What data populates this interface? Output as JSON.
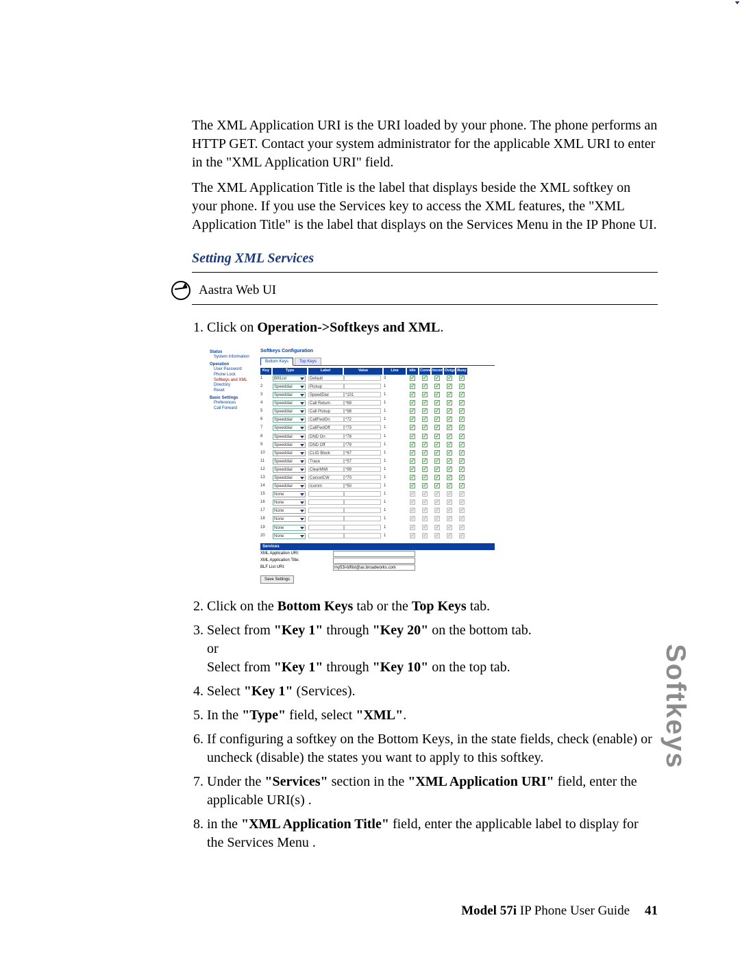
{
  "paragraphs": {
    "p1": "The XML Application URI is the URI loaded by your phone. The phone performs an HTTP GET. Contact your system administrator for the applicable XML URI to enter in the \"XML Application URI\" field.",
    "p2": "The XML Application Title is the label that displays beside the XML softkey on your phone. If you use the Services key to access the XML features, the \"XML Application Title\" is the label that displays on the Services Menu in the IP Phone UI."
  },
  "section_heading": "Setting XML Services",
  "globe_label": "Aastra Web UI",
  "steps": {
    "s1_a": "Click on ",
    "s1_b": "Operation->Softkeys and XML",
    "s1_c": ".",
    "s2_a": "Click on the ",
    "s2_b": "Bottom Keys",
    "s2_c": " tab or the ",
    "s2_d": "Top Keys",
    "s2_e": " tab.",
    "s3_a": "Select from ",
    "s3_b": "\"Key 1\"",
    "s3_c": " through ",
    "s3_d": "\"Key 20\"",
    "s3_e": " on the bottom tab.",
    "s3_or": "or",
    "s3_f": "Select from ",
    "s3_g": "\"Key 1\"",
    "s3_h": " through ",
    "s3_i": "\"Key 10\"",
    "s3_j": " on the top tab.",
    "s4_a": "Select ",
    "s4_b": "\"Key 1\"",
    "s4_c": " (Services).",
    "s5_a": "In the ",
    "s5_b": "\"Type\"",
    "s5_c": " field, select ",
    "s5_d": "\"XML\"",
    "s5_e": ".",
    "s6": "If configuring a softkey on the Bottom Keys, in the state fields, check (enable) or uncheck (disable) the states you want to apply to this softkey.",
    "s7_a": "Under the ",
    "s7_b": "\"Services\"",
    "s7_c": " section in the ",
    "s7_d": "\"XML Application URI\"",
    "s7_e": " field, enter the applicable URI(s) .",
    "s8_a": "in the ",
    "s8_b": "\"XML Application Title\"",
    "s8_c": " field, enter the applicable label to display for the Services Menu ."
  },
  "ui": {
    "nav": {
      "status": "Status",
      "system_info": "System Information",
      "operation": "Operation",
      "user_password": "User Password",
      "phone_lock": "Phone Lock",
      "softkeys_xml": "Softkeys and XML",
      "directory": "Directory",
      "reset": "Reset",
      "basic_settings": "Basic Settings",
      "preferences": "Preferences",
      "call_forward": "Call Forward"
    },
    "panel_title": "Softkeys Configuration",
    "tabs": {
      "bottom": "Bottom Keys",
      "top": "Top Keys"
    },
    "headers": {
      "key": "Key",
      "type": "Type",
      "label": "Label",
      "value": "Value",
      "line": "Line",
      "idle": "Idle",
      "connected": "Connected",
      "incoming": "Incoming",
      "outgoing": "Outgoing",
      "busy": "Busy"
    },
    "rows": [
      {
        "key": "1",
        "type": "Blf/List",
        "label": "Default",
        "value": "",
        "line": "3",
        "enabled": true
      },
      {
        "key": "2",
        "type": "Speeddial",
        "label": "Pickup",
        "value": "",
        "line": "1",
        "enabled": true
      },
      {
        "key": "3",
        "type": "Speeddial",
        "label": "SpeedDial",
        "value": "*101",
        "line": "1",
        "enabled": true
      },
      {
        "key": "4",
        "type": "Speeddial",
        "label": "Call Return",
        "value": "*69",
        "line": "1",
        "enabled": true
      },
      {
        "key": "5",
        "type": "Speeddial",
        "label": "Call Pickup",
        "value": "*98",
        "line": "1",
        "enabled": true
      },
      {
        "key": "6",
        "type": "Speeddial",
        "label": "CallFwdOn",
        "value": "*72",
        "line": "1",
        "enabled": true
      },
      {
        "key": "7",
        "type": "Speeddial",
        "label": "CallFwdOff",
        "value": "*73",
        "line": "1",
        "enabled": true
      },
      {
        "key": "8",
        "type": "Speeddial",
        "label": "DND On",
        "value": "*78",
        "line": "1",
        "enabled": true
      },
      {
        "key": "9",
        "type": "Speeddial",
        "label": "DND Off",
        "value": "*79",
        "line": "1",
        "enabled": true
      },
      {
        "key": "10",
        "type": "Speeddial",
        "label": "CLID Block",
        "value": "*67",
        "line": "1",
        "enabled": true
      },
      {
        "key": "11",
        "type": "Speeddial",
        "label": "Trace",
        "value": "*57",
        "line": "1",
        "enabled": true
      },
      {
        "key": "12",
        "type": "Speeddial",
        "label": "ClearMWI",
        "value": "*99",
        "line": "1",
        "enabled": true
      },
      {
        "key": "13",
        "type": "Speeddial",
        "label": "CancelCW",
        "value": "*70",
        "line": "1",
        "enabled": true
      },
      {
        "key": "14",
        "type": "Speeddial",
        "label": "Icomm",
        "value": "*50",
        "line": "1",
        "enabled": true
      },
      {
        "key": "15",
        "type": "None",
        "label": "",
        "value": "",
        "line": "1",
        "enabled": false
      },
      {
        "key": "16",
        "type": "None",
        "label": "",
        "value": "",
        "line": "1",
        "enabled": false
      },
      {
        "key": "17",
        "type": "None",
        "label": "",
        "value": "",
        "line": "1",
        "enabled": false
      },
      {
        "key": "18",
        "type": "None",
        "label": "",
        "value": "",
        "line": "1",
        "enabled": false
      },
      {
        "key": "19",
        "type": "None",
        "label": "",
        "value": "",
        "line": "1",
        "enabled": false
      },
      {
        "key": "20",
        "type": "None",
        "label": "",
        "value": "",
        "line": "1",
        "enabled": false
      }
    ],
    "services_header": "Services",
    "xml_uri_label": "XML Application URI:",
    "xml_title_label": "XML Application Title:",
    "blf_label": "BLF List URI:",
    "blf_value": "my53i-blflist@as.broadworks.com",
    "save": "Save Settings"
  },
  "side_label": "Softkeys",
  "footer": {
    "model": "Model 57i ",
    "guide": "IP Phone User Guide",
    "page": "41"
  }
}
